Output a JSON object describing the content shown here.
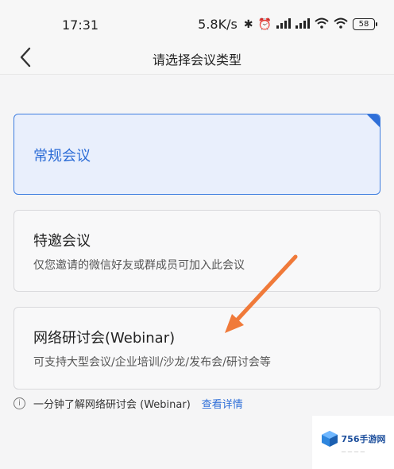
{
  "status": {
    "time": "17:31",
    "speed": "5.8K/s",
    "battery": "58"
  },
  "nav": {
    "title": "请选择会议类型"
  },
  "options": [
    {
      "title": "常规会议",
      "description": "",
      "selected": true
    },
    {
      "title": "特邀会议",
      "description": "仅您邀请的微信好友或群成员可加入此会议",
      "selected": false
    },
    {
      "title": "网络研讨会(Webinar)",
      "description": "可支持大型会议/企业培训/沙龙/发布会/研讨会等",
      "selected": false
    }
  ],
  "info": {
    "text": "一分钟了解网络研讨会 (Webinar)",
    "link": "查看详情"
  },
  "watermark": {
    "text": "756手游网"
  },
  "colors": {
    "accent": "#2f6fd8",
    "arrow": "#f07a3a"
  }
}
